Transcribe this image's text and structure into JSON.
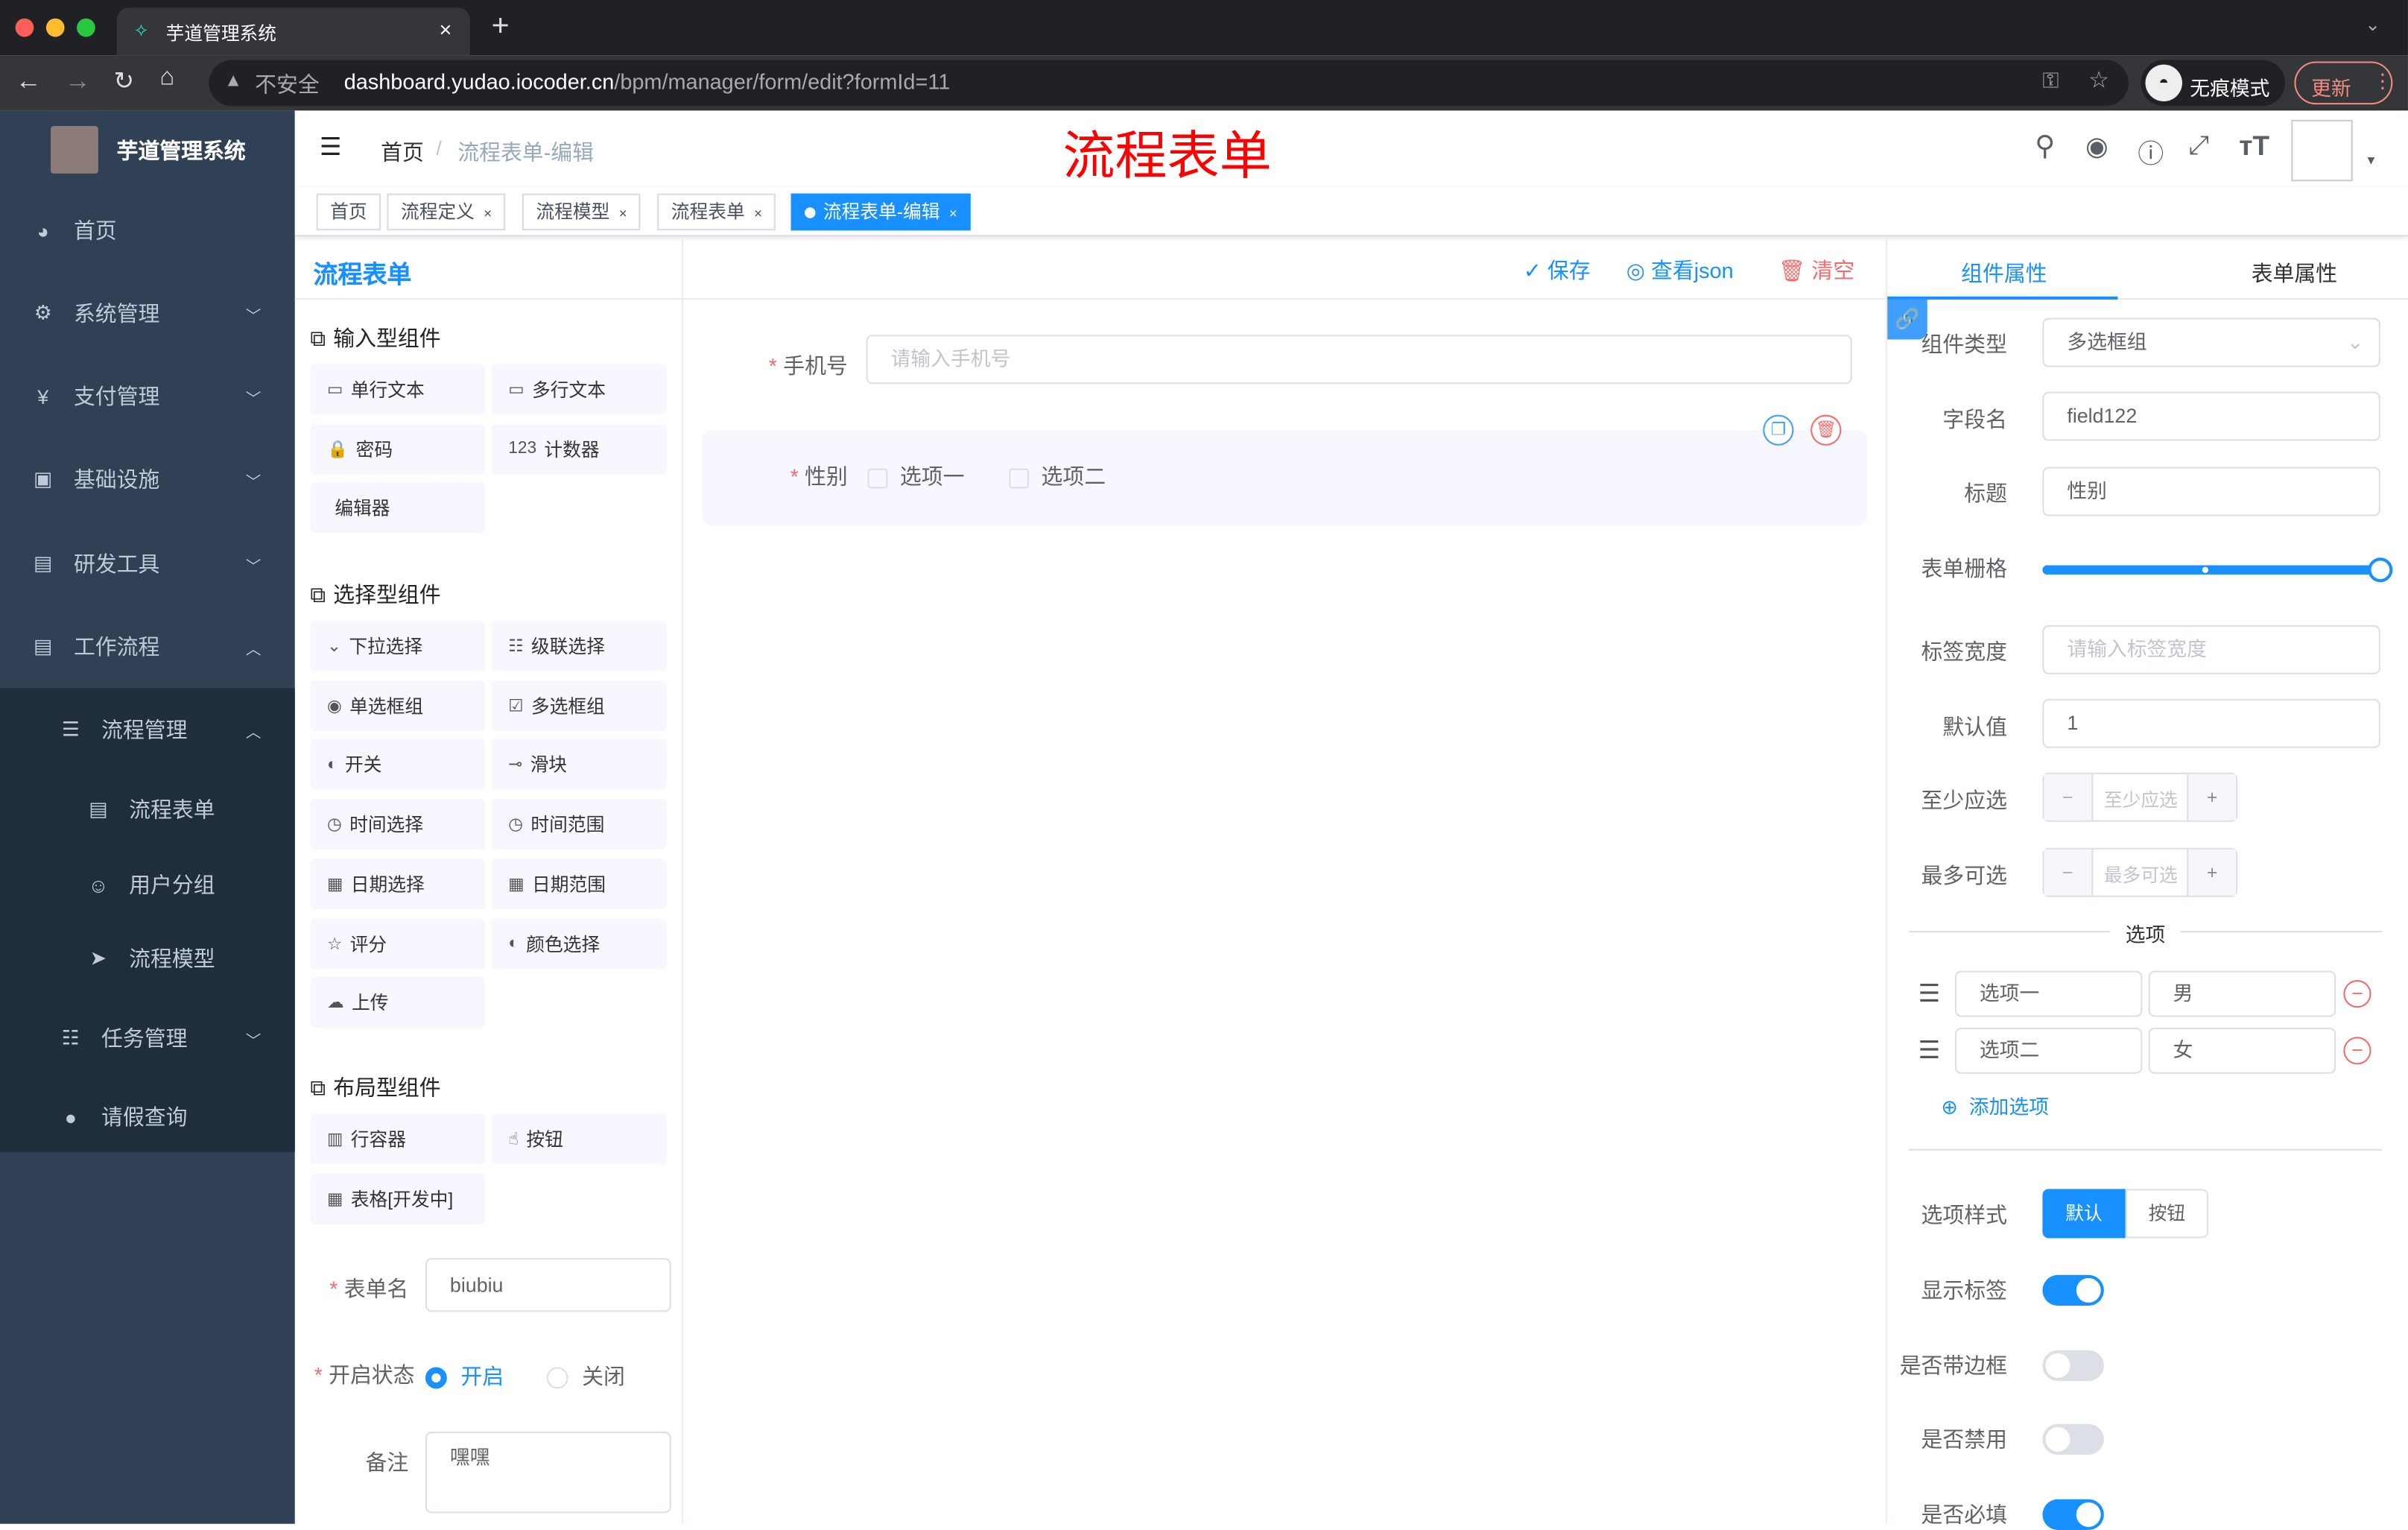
{
  "browser": {
    "tab_title": "芋道管理系统",
    "new_tab": "+",
    "insecure": "不安全",
    "url_host": "dashboard.yudao.iocoder.cn",
    "url_path": "/bpm/manager/form/edit?formId=11",
    "incognito": "无痕模式",
    "update": "更新"
  },
  "sidebar": {
    "app_name": "芋道管理系统",
    "items": [
      {
        "label": "首页"
      },
      {
        "label": "系统管理"
      },
      {
        "label": "支付管理"
      },
      {
        "label": "基础设施"
      },
      {
        "label": "研发工具"
      },
      {
        "label": "工作流程"
      },
      {
        "label": "流程管理"
      },
      {
        "label": "流程表单"
      },
      {
        "label": "用户分组"
      },
      {
        "label": "流程模型"
      },
      {
        "label": "任务管理"
      },
      {
        "label": "请假查询"
      }
    ]
  },
  "navbar": {
    "breadcrumb": [
      "首页",
      "流程表单-编辑"
    ],
    "overlay_title": "流程表单"
  },
  "tags": [
    {
      "label": "首页"
    },
    {
      "label": "流程定义"
    },
    {
      "label": "流程模型"
    },
    {
      "label": "流程表单"
    },
    {
      "label": "流程表单-编辑",
      "active": true
    }
  ],
  "header": {
    "title": "流程表单",
    "save": "保存",
    "view_json": "查看json",
    "clear": "清空"
  },
  "components": {
    "input_group": "输入型组件",
    "input": [
      "单行文本",
      "多行文本",
      "密码",
      "计数器",
      "编辑器"
    ],
    "select_group": "选择型组件",
    "select": [
      "下拉选择",
      "级联选择",
      "单选框组",
      "多选框组",
      "开关",
      "滑块",
      "时间选择",
      "时间范围",
      "日期选择",
      "日期范围",
      "评分",
      "颜色选择",
      "上传"
    ],
    "layout_group": "布局型组件",
    "layout": [
      "行容器",
      "按钮",
      "表格[开发中]"
    ]
  },
  "form_meta": {
    "name_label": "表单名",
    "name_value": "biubiu",
    "status_label": "开启状态",
    "status_on": "开启",
    "status_off": "关闭",
    "status": "开启",
    "remark_label": "备注",
    "remark_value": "嘿嘿"
  },
  "canvas": {
    "phone_label": "手机号",
    "phone_placeholder": "请输入手机号",
    "gender_label": "性别",
    "options": [
      "选项一",
      "选项二"
    ]
  },
  "props": {
    "tab_component": "组件属性",
    "tab_form": "表单属性",
    "type_label": "组件类型",
    "type_value": "多选框组",
    "field_label": "字段名",
    "field_value": "field122",
    "title_label": "标题",
    "title_value": "性别",
    "grid_label": "表单栅格",
    "grid_value": 24,
    "label_width_label": "标签宽度",
    "label_width_placeholder": "请输入标签宽度",
    "default_label": "默认值",
    "default_value": "1",
    "min_label": "至少应选",
    "min_placeholder": "至少应选",
    "max_label": "最多可选",
    "max_placeholder": "最多可选",
    "options_divider": "选项",
    "options": [
      {
        "label": "选项一",
        "value": "男"
      },
      {
        "label": "选项二",
        "value": "女"
      }
    ],
    "add_option": "添加选项",
    "style_label": "选项样式",
    "style_default": "默认",
    "style_button": "按钮",
    "show_label": "显示标签",
    "show_label_on": true,
    "border_label": "是否带边框",
    "border_on": false,
    "disabled_label": "是否禁用",
    "disabled_on": false,
    "required_label": "是否必填",
    "required_on": true
  },
  "colors": {
    "accent": "#1890ff",
    "sidebar": "#304156",
    "danger": "#f56c6c"
  }
}
